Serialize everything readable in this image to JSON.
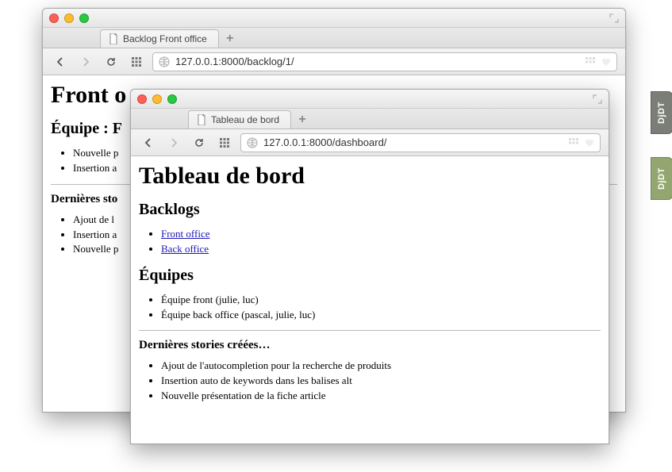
{
  "back_window": {
    "tab_title": "Backlog Front office",
    "url": "127.0.0.1:8000/backlog/1/",
    "djdt": "DjDT",
    "h1": "Front o",
    "h2_team": "Équipe : F",
    "team_items": [
      "Nouvelle p",
      "Insertion a"
    ],
    "h3_stories": "Dernières sto",
    "stories_items": [
      "Ajout de l",
      "Insertion a",
      "Nouvelle p"
    ]
  },
  "front_window": {
    "tab_title": "Tableau de bord",
    "url": "127.0.0.1:8000/dashboard/",
    "djdt": "DjDT",
    "h1": "Tableau de bord",
    "h2_backlogs": "Backlogs",
    "backlog_links": [
      "Front office",
      "Back office"
    ],
    "h2_teams": "Équipes",
    "team_items": [
      "Équipe front (julie, luc)",
      "Équipe back office (pascal, julie, luc)"
    ],
    "h3_stories": "Dernières stories créées…",
    "stories_items": [
      "Ajout de l'autocompletion pour la recherche de produits",
      "Insertion auto de keywords dans les balises alt",
      "Nouvelle présentation de la fiche article"
    ]
  }
}
